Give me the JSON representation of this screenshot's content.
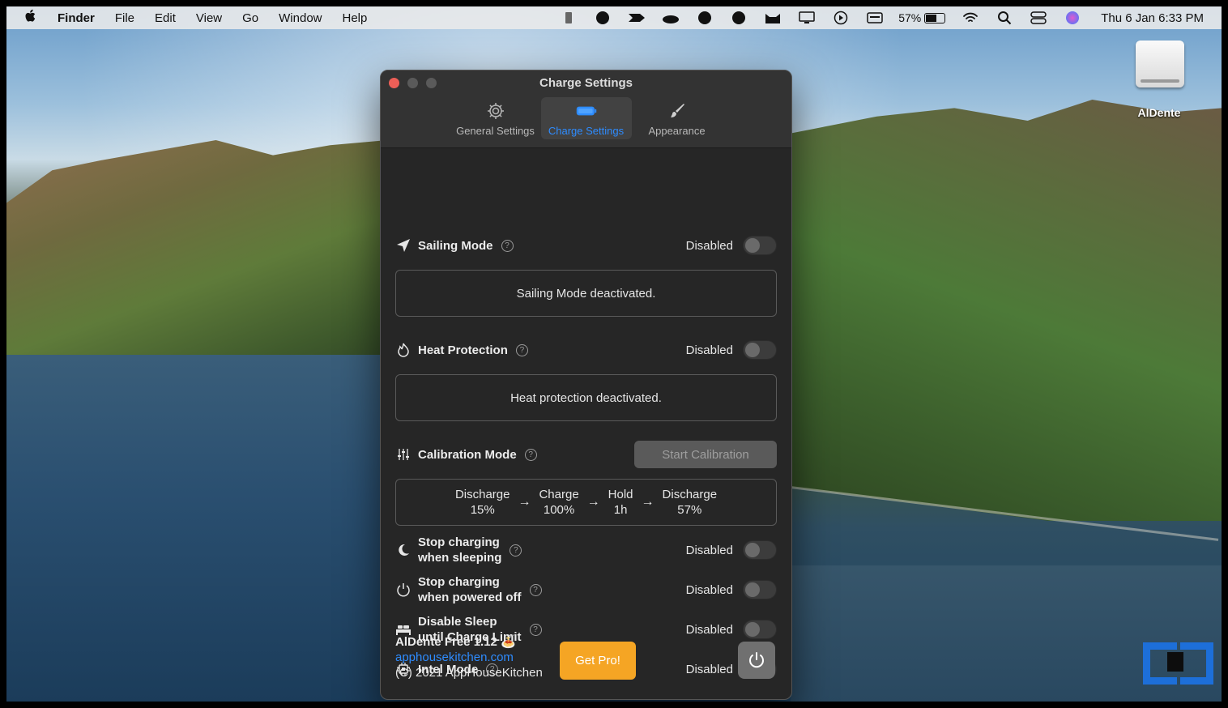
{
  "menubar": {
    "app_name": "Finder",
    "menus": [
      "File",
      "Edit",
      "View",
      "Go",
      "Window",
      "Help"
    ],
    "battery_percent": "57%",
    "clock": "Thu 6 Jan  6:33 PM"
  },
  "desktop": {
    "drive_label": "AlDente"
  },
  "window": {
    "title": "Charge Settings",
    "tabs": [
      {
        "label": "General Settings",
        "icon": "gear-icon",
        "active": false
      },
      {
        "label": "Charge Settings",
        "icon": "battery-icon",
        "active": true
      },
      {
        "label": "Appearance",
        "icon": "brush-icon",
        "active": false
      }
    ],
    "sailing": {
      "label": "Sailing Mode",
      "status": "Disabled",
      "message": "Sailing Mode deactivated.",
      "enabled": false
    },
    "heat": {
      "label": "Heat Protection",
      "status": "Disabled",
      "message": "Heat protection deactivated.",
      "enabled": false
    },
    "calibration": {
      "label": "Calibration Mode",
      "button": "Start Calibration",
      "steps": [
        {
          "name": "Discharge",
          "value": "15%"
        },
        {
          "name": "Charge",
          "value": "100%"
        },
        {
          "name": "Hold",
          "value": "1h"
        },
        {
          "name": "Discharge",
          "value": "57%"
        }
      ]
    },
    "stop_sleeping": {
      "line1": "Stop charging",
      "line2": "when sleeping",
      "status": "Disabled",
      "enabled": false
    },
    "stop_powered_off": {
      "line1": "Stop charging",
      "line2": "when powered off",
      "status": "Disabled",
      "enabled": false
    },
    "disable_sleep": {
      "line1": "Disable Sleep",
      "line2": "until Charge Limit",
      "status": "Disabled",
      "enabled": false
    },
    "intel": {
      "label": "Intel Mode",
      "status": "Disabled",
      "enabled": false
    },
    "footer": {
      "version": "AlDente Free 1.12 🍝",
      "website": "apphousekitchen.com",
      "copyright": "(C) 2021 AppHouseKitchen",
      "get_pro": "Get Pro!"
    }
  },
  "colors": {
    "accent": "#2e8cff",
    "get_pro": "#f5a524",
    "close": "#ed5f57"
  }
}
